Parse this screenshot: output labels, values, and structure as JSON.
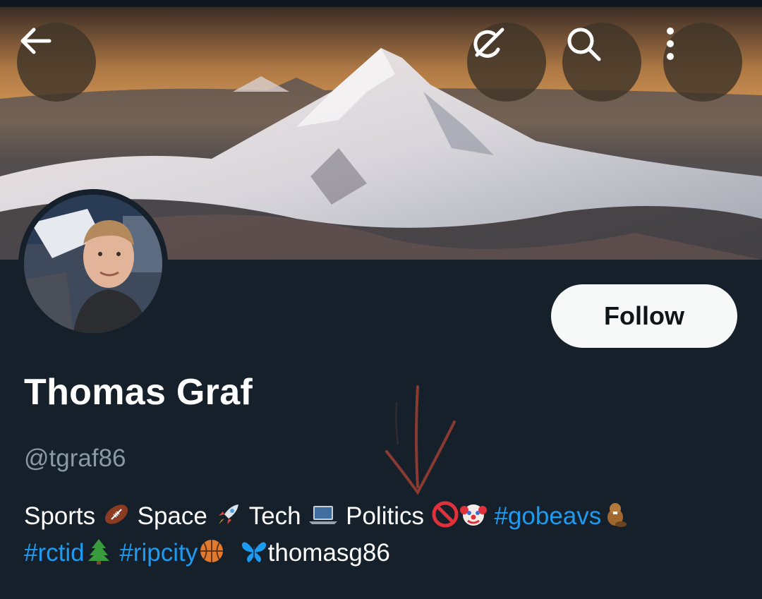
{
  "profile": {
    "name": "Thomas Graf",
    "handle": "@tgraf86",
    "follow_label": "Follow"
  },
  "bio": {
    "word_sports": "Sports",
    "word_space": "Space",
    "word_tech": "Tech",
    "word_politics": "Politics",
    "tag_gobeavs": "#gobeavs",
    "tag_rctid": "#rctid",
    "tag_ripcity": "#ripcity",
    "bluesky": "thomasg86"
  },
  "icons": {
    "back": "back-arrow-icon",
    "grok": "grok-icon",
    "search": "search-icon",
    "more": "more-vertical-icon",
    "football": "football-emoji",
    "rocket": "rocket-emoji",
    "laptop": "laptop-emoji",
    "no_entry": "prohibited-emoji",
    "clown": "clown-face-emoji",
    "beaver": "beaver-emoji",
    "tree": "evergreen-tree-emoji",
    "basketball": "basketball-emoji",
    "butterfly": "butterfly-emoji"
  },
  "colors": {
    "background": "#15202b",
    "link": "#1d9bf0",
    "handle": "#8b98a5",
    "annotation_arrow": "#8a3a30"
  }
}
